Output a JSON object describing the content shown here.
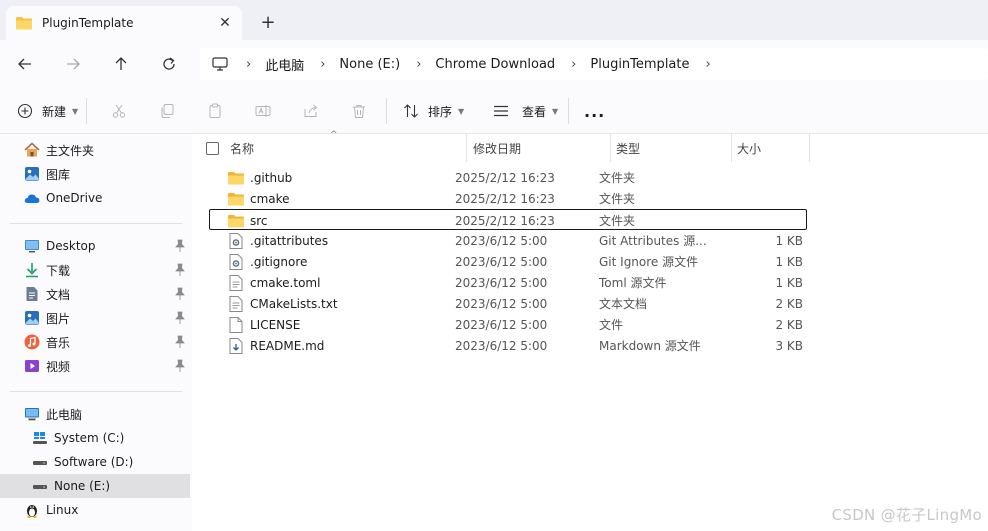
{
  "tab": {
    "title": "PluginTemplate",
    "close": "✕",
    "new": "+"
  },
  "nav": {
    "back": "back",
    "forward": "forward",
    "up": "up",
    "refresh": "refresh"
  },
  "breadcrumb": {
    "separator": "›",
    "items": [
      "此电脑",
      "None (E:)",
      "Chrome Download",
      "PluginTemplate"
    ]
  },
  "command_bar": {
    "new_label": "新建",
    "sort_label": "排序",
    "view_label": "查看",
    "more": "..."
  },
  "sidebar": {
    "quick": [
      {
        "label": "主文件夹",
        "icon": "home-icon"
      },
      {
        "label": "图库",
        "icon": "gallery-icon"
      },
      {
        "label": "OneDrive",
        "icon": "cloud-icon"
      }
    ],
    "pinned": [
      {
        "label": "Desktop",
        "icon": "desktop-icon"
      },
      {
        "label": "下载",
        "icon": "download-icon"
      },
      {
        "label": "文档",
        "icon": "document-icon"
      },
      {
        "label": "图片",
        "icon": "picture-icon"
      },
      {
        "label": "音乐",
        "icon": "music-icon"
      },
      {
        "label": "视频",
        "icon": "video-icon"
      }
    ],
    "pc": {
      "label": "此电脑",
      "icon": "computer-icon"
    },
    "drives": [
      {
        "label": "System (C:)",
        "icon": "windows-drive-icon"
      },
      {
        "label": "Software (D:)",
        "icon": "drive-icon"
      },
      {
        "label": "None (E:)",
        "icon": "drive-icon",
        "selected": true
      }
    ],
    "linux": {
      "label": "Linux",
      "icon": "penguin-icon"
    }
  },
  "columns": {
    "name": "名称",
    "date": "修改日期",
    "type": "类型",
    "size": "大小"
  },
  "files": [
    {
      "name": ".github",
      "date": "2025/2/12 16:23",
      "type": "文件夹",
      "size": "",
      "icon": "folder-icon"
    },
    {
      "name": "cmake",
      "date": "2025/2/12 16:23",
      "type": "文件夹",
      "size": "",
      "icon": "folder-icon"
    },
    {
      "name": "src",
      "date": "2025/2/12 16:23",
      "type": "文件夹",
      "size": "",
      "icon": "folder-icon",
      "selected": true
    },
    {
      "name": ".gitattributes",
      "date": "2023/6/12 5:00",
      "type": "Git Attributes 源...",
      "size": "1 KB",
      "icon": "config-file-icon"
    },
    {
      "name": ".gitignore",
      "date": "2023/6/12 5:00",
      "type": "Git Ignore 源文件",
      "size": "1 KB",
      "icon": "config-file-icon"
    },
    {
      "name": "cmake.toml",
      "date": "2023/6/12 5:00",
      "type": "Toml 源文件",
      "size": "1 KB",
      "icon": "text-file-icon"
    },
    {
      "name": "CMakeLists.txt",
      "date": "2023/6/12 5:00",
      "type": "文本文档",
      "size": "2 KB",
      "icon": "text-file-icon"
    },
    {
      "name": "LICENSE",
      "date": "2023/6/12 5:00",
      "type": "文件",
      "size": "2 KB",
      "icon": "blank-file-icon"
    },
    {
      "name": "README.md",
      "date": "2023/6/12 5:00",
      "type": "Markdown 源文件",
      "size": "3 KB",
      "icon": "markdown-file-icon"
    }
  ],
  "watermark": "CSDN @花子LingMo",
  "colors": {
    "folder": "#f5c24c",
    "accent": "#0067c0",
    "selected_bg": "#e0e0e3"
  }
}
